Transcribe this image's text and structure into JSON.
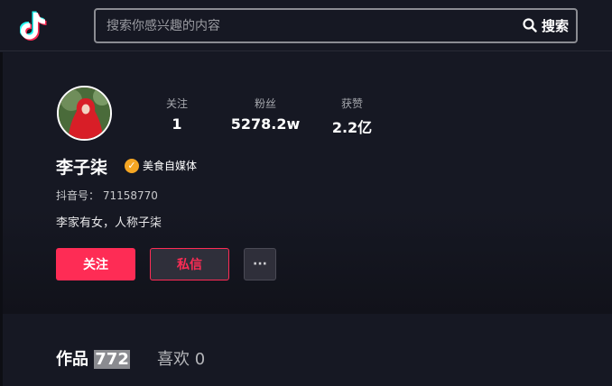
{
  "header": {
    "logo": "tiktok-logo-icon",
    "search": {
      "placeholder": "搜索你感兴趣的内容",
      "button_label": "搜索"
    }
  },
  "profile": {
    "stats": [
      {
        "label": "关注",
        "value": "1"
      },
      {
        "label": "粉丝",
        "value": "5278.2w"
      },
      {
        "label": "获赞",
        "value": "2.2亿"
      }
    ],
    "name": "李子柒",
    "badge": "美食自媒体",
    "uid_label": "抖音号：",
    "uid": "71158770",
    "bio": "李家有女，人称子柒",
    "follow_label": "关注",
    "message_label": "私信",
    "more_label": "···"
  },
  "tabs": {
    "works_label": "作品",
    "works_count": "772",
    "likes_label": "喜欢",
    "likes_count": "0"
  },
  "colors": {
    "accent": "#fe2c55",
    "background": "#161823",
    "badge": "#f5a623"
  }
}
